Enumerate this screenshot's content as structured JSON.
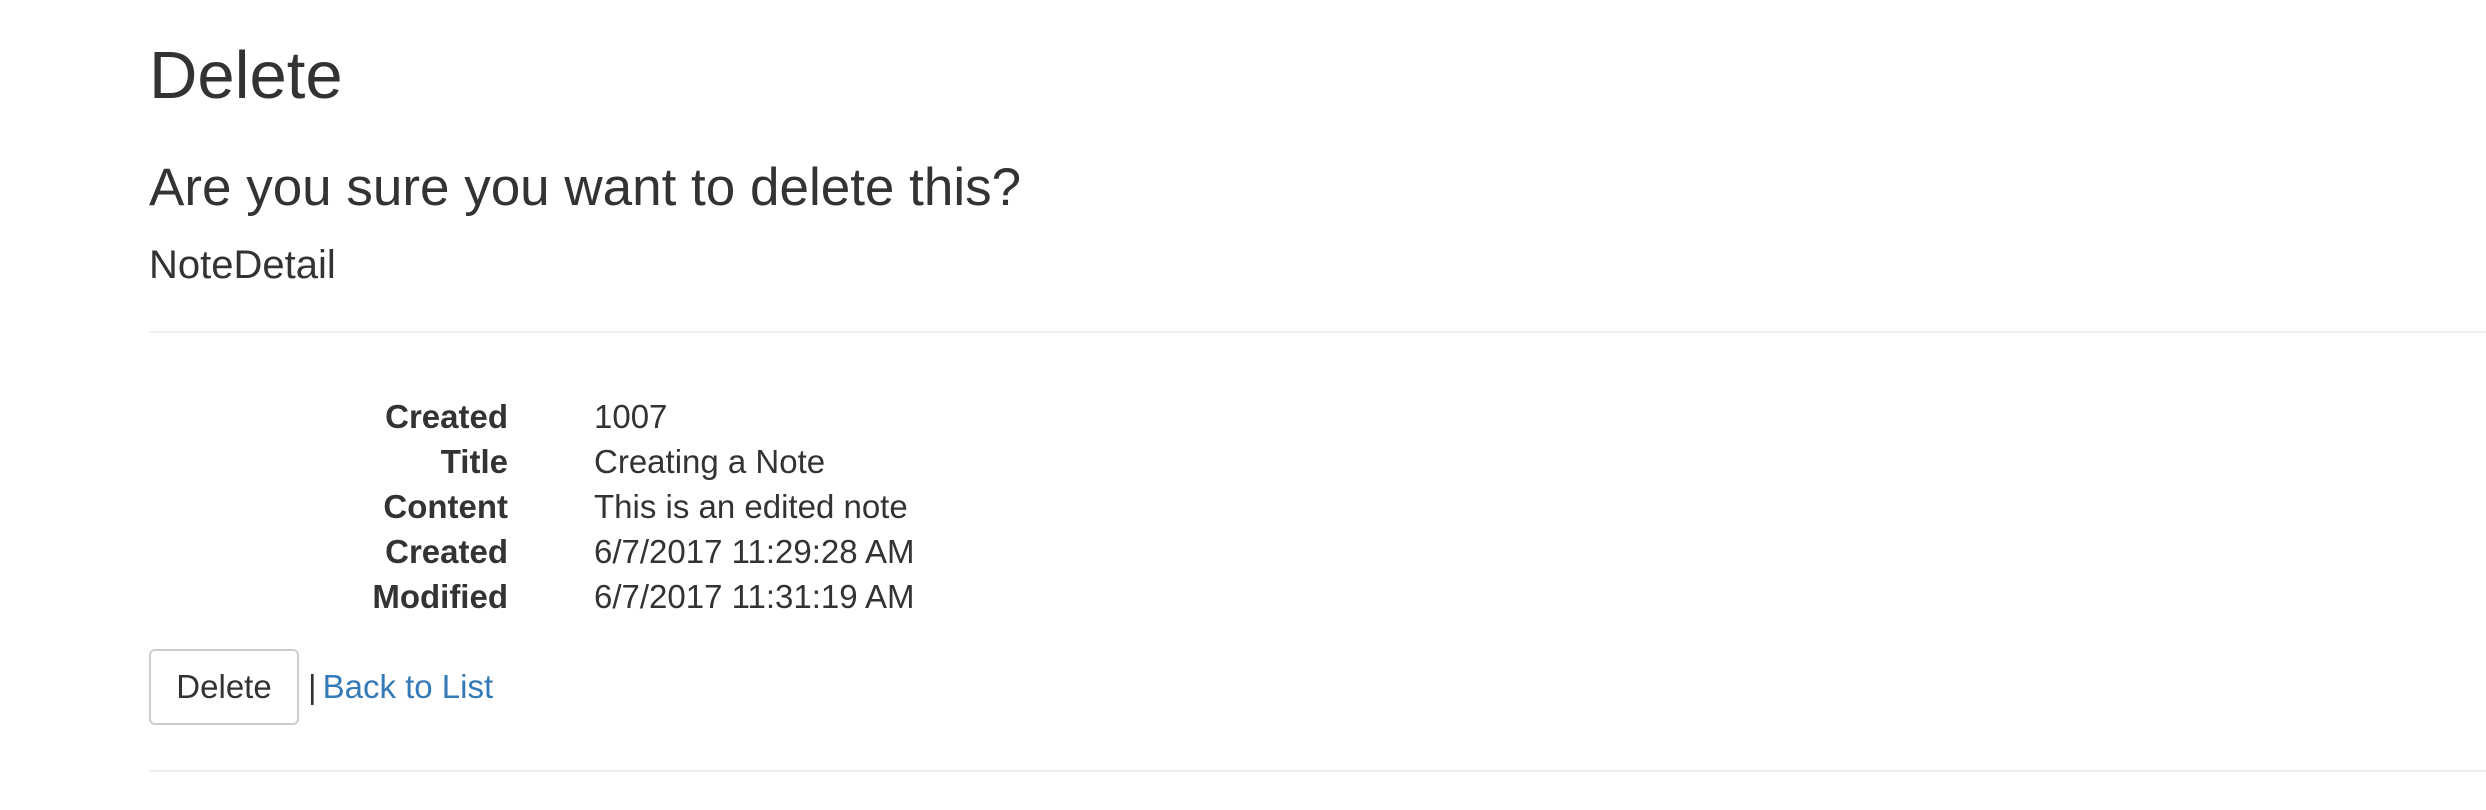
{
  "page": {
    "title": "Delete",
    "question": "Are you sure you want to delete this?",
    "model_name": "NoteDetail"
  },
  "details": [
    {
      "label": "Created",
      "value": "1007"
    },
    {
      "label": "Title",
      "value": "Creating a Note"
    },
    {
      "label": "Content",
      "value": "This is an edited note"
    },
    {
      "label": "Created",
      "value": "6/7/2017 11:29:28 AM"
    },
    {
      "label": "Modified",
      "value": "6/7/2017 11:31:19 AM"
    }
  ],
  "actions": {
    "delete_label": "Delete",
    "separator": "|",
    "back_label": "Back to List"
  },
  "colors": {
    "text": "#333333",
    "link": "#337ab7",
    "divider": "#eeeeee",
    "button_border": "#cccccc"
  }
}
